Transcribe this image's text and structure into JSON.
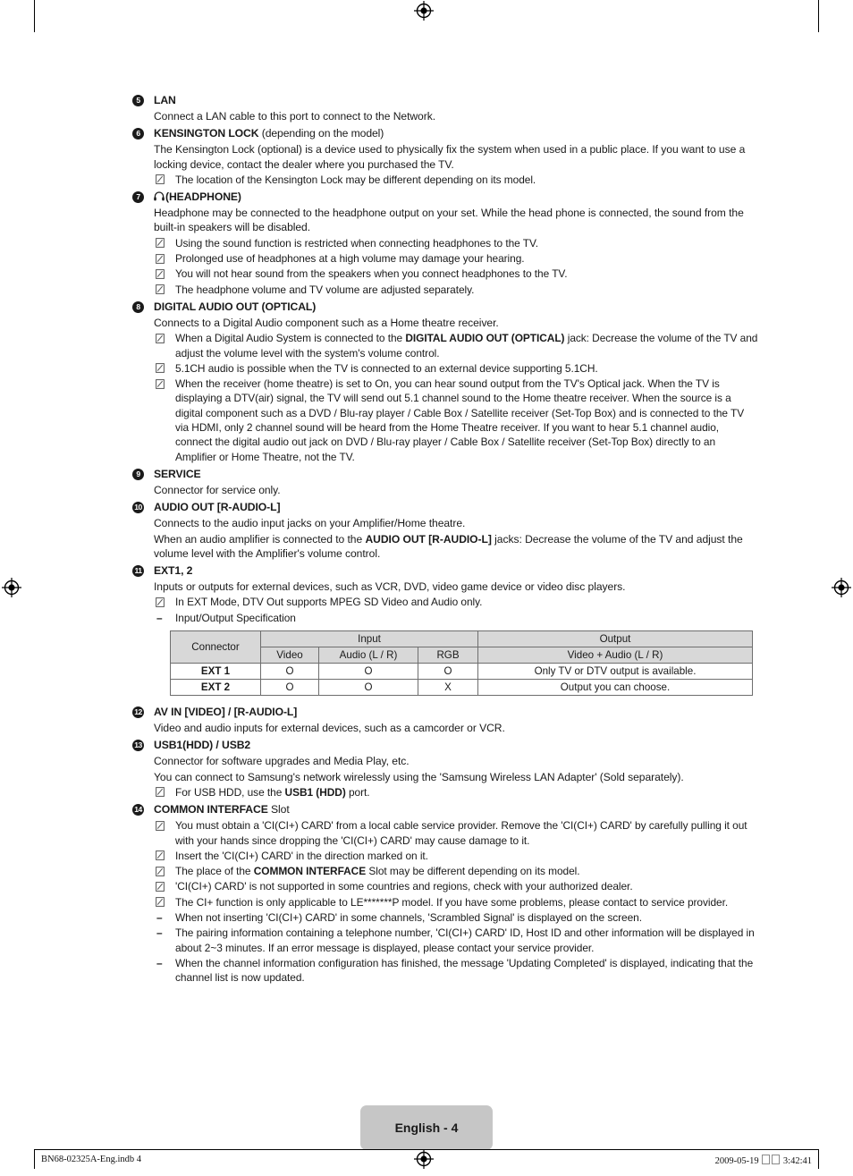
{
  "page": {
    "page_label": "English - 4",
    "footer_left": "BN68-02325A-Eng.indb   4",
    "footer_date": "2009-05-19",
    "footer_time": "3:42:41"
  },
  "items": [
    {
      "number": "5",
      "title": "LAN",
      "title_suffix": "",
      "lines": [
        "Connect a LAN cable to this port to connect to the Network."
      ],
      "notes": [],
      "dashes": []
    },
    {
      "number": "6",
      "title": "KENSINGTON LOCK",
      "title_suffix": " (depending on the model)",
      "lines": [
        "The Kensington Lock (optional) is a device used to physically fix the system when used in a public place. If you want to use a locking device, contact the dealer where you purchased the TV."
      ],
      "notes": [
        "The location of the Kensington Lock may be different depending on its model."
      ],
      "dashes": []
    },
    {
      "number": "7",
      "title": "(HEADPHONE)",
      "title_suffix": "",
      "title_icon": "headphone-icon",
      "lines": [
        "Headphone may be connected to the headphone output on your set. While the head phone is connected, the sound from the built-in speakers will be disabled."
      ],
      "notes": [
        "Using the sound function is restricted when connecting headphones to the TV.",
        "Prolonged use of headphones at a high volume may damage your hearing.",
        "You will not hear sound from the speakers when you connect headphones to the TV.",
        "The headphone volume and TV volume are adjusted separately."
      ],
      "dashes": []
    },
    {
      "number": "8",
      "title": "DIGITAL AUDIO OUT (OPTICAL)",
      "title_suffix": "",
      "lines": [
        "Connects to a Digital Audio component such as a Home theatre receiver."
      ],
      "notes_html": [
        "When a Digital Audio System is connected to the <b>DIGITAL AUDIO OUT (OPTICAL)</b> jack: Decrease the volume of the TV and adjust the volume level with the system's volume control.",
        "5.1CH audio is possible when the TV is connected to an external device supporting 5.1CH.",
        "When the receiver (home theatre) is set to On, you can hear sound output from the TV's Optical jack. When the TV is displaying a DTV(air) signal, the TV will send out 5.1 channel sound to the Home theatre receiver. When the source is a digital component such as a DVD / Blu-ray player / Cable Box / Satellite receiver (Set-Top Box) and is connected to the TV via HDMI, only 2 channel sound will be heard from the Home Theatre receiver. If you want to hear 5.1 channel audio, connect the digital audio out jack on DVD / Blu-ray player / Cable Box / Satellite receiver (Set-Top Box) directly to an Amplifier or Home Theatre, not the TV."
      ],
      "notes": [],
      "dashes": []
    },
    {
      "number": "9",
      "title": "SERVICE",
      "title_suffix": "",
      "lines": [
        "Connector for service only."
      ],
      "notes": [],
      "dashes": []
    },
    {
      "number": "10",
      "title": "AUDIO OUT [R-AUDIO-L]",
      "title_suffix": "",
      "lines": [
        "Connects to the audio input jacks on your Amplifier/Home theatre."
      ],
      "lines_html": [
        "When an audio amplifier is connected to the <b>AUDIO OUT [R-AUDIO-L]</b> jacks: Decrease the volume of the TV and adjust the volume level with the Amplifier's volume control."
      ],
      "notes": [],
      "dashes": []
    },
    {
      "number": "11",
      "title": "EXT1, 2",
      "title_suffix": "",
      "lines": [
        "Inputs or outputs for external devices, such as VCR, DVD, video game device or video disc players."
      ],
      "notes": [
        "In EXT Mode, DTV Out supports MPEG SD Video and Audio only."
      ],
      "dashes": [
        "Input/Output Specification"
      ],
      "has_table": true
    },
    {
      "number": "12",
      "title": "AV IN [VIDEO] / [R-AUDIO-L]",
      "title_suffix": "",
      "lines": [
        "Video and audio inputs for external devices, such as a camcorder or VCR."
      ],
      "notes": [],
      "dashes": []
    },
    {
      "number": "13",
      "title": "USB1(HDD) / USB2",
      "title_suffix": "",
      "lines": [
        "Connector for software upgrades and Media Play, etc.",
        "You can connect to Samsung's network wirelessly using the 'Samsung Wireless LAN Adapter' (Sold separately)."
      ],
      "notes_html": [
        "For USB HDD, use the <b>USB1 (HDD)</b> port."
      ],
      "notes": [],
      "dashes": []
    },
    {
      "number": "14",
      "title": "COMMON INTERFACE",
      "title_suffix": " Slot",
      "lines": [],
      "dashes": [
        "When not inserting 'CI(CI+) CARD' in some channels, 'Scrambled Signal' is displayed on the screen.",
        "The pairing information containing a telephone number, 'CI(CI+) CARD' ID, Host ID and other information will be displayed in about 2~3 minutes. If an error message is displayed, please contact your service provider.",
        "When the channel information configuration has finished, the message 'Updating Completed' is displayed, indicating that the channel list is now updated."
      ],
      "notes_html": [
        "You must obtain a 'CI(CI+) CARD' from a local cable service provider. Remove the 'CI(CI+) CARD' by carefully pulling it out with your hands since dropping the 'CI(CI+) CARD' may cause damage to it.",
        "Insert the 'CI(CI+) CARD' in the direction marked on it.",
        "The place of the <b>COMMON INTERFACE</b> Slot may be different depending on its model.",
        "'CI(CI+) CARD' is not supported in some countries and regions, check with your authorized dealer.",
        "The CI+ function is only applicable to LE*******P model. If you have some problems, please contact to service provider."
      ],
      "notes": []
    }
  ],
  "spec_table": {
    "group_headers": [
      "Connector",
      "Input",
      "Output"
    ],
    "sub_headers": [
      "Video",
      "Audio (L / R)",
      "RGB",
      "Video + Audio (L / R)"
    ],
    "rows": [
      {
        "connector": "EXT 1",
        "video": "O",
        "audio": "O",
        "rgb": "O",
        "output": "Only TV or DTV output is available."
      },
      {
        "connector": "EXT 2",
        "video": "O",
        "audio": "O",
        "rgb": "X",
        "output": "Output you can choose."
      }
    ]
  },
  "colors": {
    "header_fill": "#d8d8d8",
    "badge_fill": "#c6c6c6",
    "text": "#1a1a1a",
    "rule": "#6e6e6e"
  }
}
